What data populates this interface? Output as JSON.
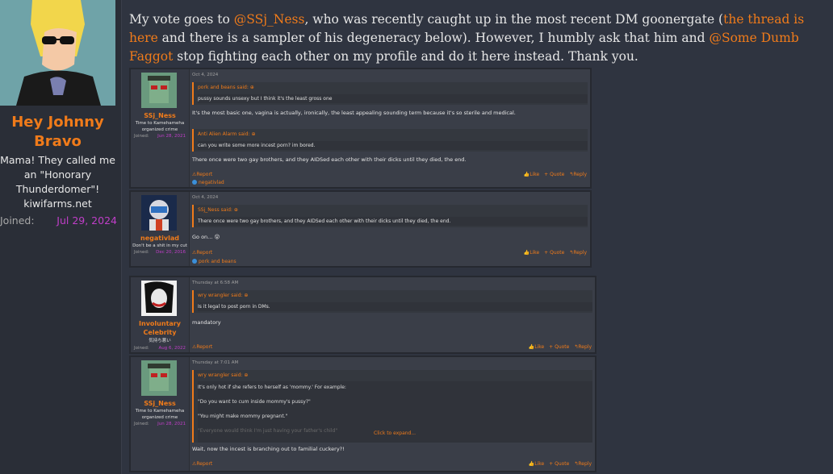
{
  "profile": {
    "name": "Hey Johnny Bravo",
    "title": "Mama! They called me an \"Honorary Thunderdomer\"!",
    "site": "kiwifarms.net",
    "joined_label": "Joined:",
    "joined_date": "Jul 29, 2024"
  },
  "message": {
    "p1": "My vote goes to ",
    "mention1": "@SSj_Ness",
    "p2": ", who was recently caught up in the most recent DM goonergate (",
    "thread_link": "the thread is here",
    "p3": " and there is a sampler of his degeneracy below). However, I humbly ask that him and ",
    "mention2": "@Some Dumb Faggot",
    "p4": " stop fighting each other on my profile and do it here instead. Thank you."
  },
  "posts": [
    {
      "user": "SSj_Ness",
      "title": "Time to Kamehameha organized crime",
      "joined_label": "Joined:",
      "joined": "Jun 28, 2021",
      "date": "Oct 4, 2024",
      "quote1_author": "pork and beans said: ⊕",
      "quote1_text": "pussy sounds unsexy but I think it's the least gross one",
      "text1": "It's the most basic one, vagina is actually, ironically, the least appealing sounding term because it's so sterile and medical.",
      "quote2_author": "Anti Alien Alarm said: ⊕",
      "quote2_text": "can you write some more incest porn? im bored.",
      "text2": "There once were two gay brothers, and they AIDSed each other with their dicks until they died, the end.",
      "report": "⚠Report",
      "like": "👍Like",
      "quote": "+ Quote",
      "reply": "↰Reply",
      "reaction_user": "negativlad"
    },
    {
      "user": "negativlad",
      "title": "Don't be a shit in my cut",
      "joined_label": "Joined:",
      "joined": "Dec 20, 2016",
      "date": "Oct 4, 2024",
      "quote1_author": "SSj_Ness said: ⊕",
      "quote1_text": "There once were two gay brothers, and they AIDSed each other with their dicks until they died, the end.",
      "text1": "Go on... 😲",
      "report": "⚠Report",
      "like": "👍Like",
      "quote": "+ Quote",
      "reply": "↰Reply",
      "reaction_user": "pork and beans"
    },
    {
      "user": "Involuntary Celebrity",
      "title": "気持ち悪い",
      "joined_label": "Joined:",
      "joined": "Aug 6, 2022",
      "date": "Thursday at 6:58 AM",
      "quote1_author": "wry wrangler said: ⊕",
      "quote1_text": "Is it legal to post porn in DMs.",
      "text1": "mandatory",
      "report": "⚠Report",
      "like": "👍Like",
      "quote": "+ Quote",
      "reply": "↰Reply"
    },
    {
      "user": "SSj_Ness",
      "title": "Time to Kamehameha organized crime",
      "joined_label": "Joined:",
      "joined": "Jun 28, 2021",
      "date": "Thursday at 7:01 AM",
      "quote1_author": "wry wrangler said: ⊕",
      "q_line1": "It's only hot if she refers to herself as 'mommy.' For example:",
      "q_line2": "\"Do you want to cum inside mommy's pussy?\"",
      "q_line3": "\"You might make mommy pregnant.\"",
      "q_line4": "\"Everyone would think I'm just having your father's child\"",
      "expand": "Click to expand...",
      "text1": "Wait, now the incest is branching out to familial cuckery?!",
      "report": "⚠Report",
      "like": "👍Like",
      "quote": "+ Quote",
      "reply": "↰Reply"
    }
  ]
}
